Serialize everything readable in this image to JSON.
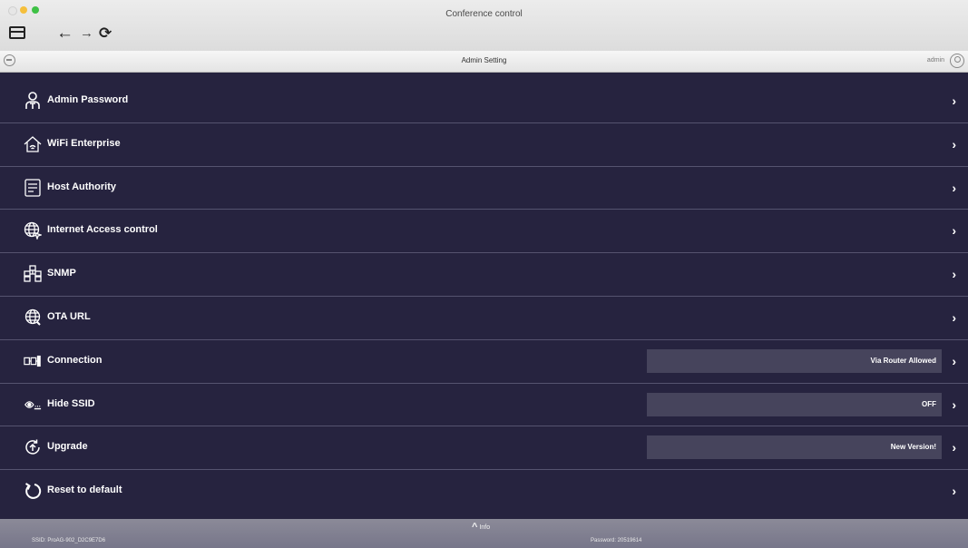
{
  "window": {
    "title": "Conference control"
  },
  "toolbar": {
    "back_label": "←",
    "forward_label": "→",
    "reload_label": "⟳"
  },
  "nav": {
    "title": "Admin Setting",
    "user": "admin"
  },
  "settings": {
    "items": [
      {
        "label": "Admin Password",
        "icon": "admin-user-icon"
      },
      {
        "label": "WiFi Enterprise",
        "icon": "house-wifi-icon"
      },
      {
        "label": "Host Authority",
        "icon": "document-list-icon"
      },
      {
        "label": "Internet Access control",
        "icon": "globe-cursor-icon"
      },
      {
        "label": "SNMP",
        "icon": "network-nodes-icon"
      },
      {
        "label": "OTA URL",
        "icon": "globe-icon"
      },
      {
        "label": "Connection",
        "icon": "connection-icon",
        "value": "Via Router Allowed"
      },
      {
        "label": "Hide SSID",
        "icon": "hide-ssid-icon",
        "value": "OFF"
      },
      {
        "label": "Upgrade",
        "icon": "upgrade-icon",
        "value": "New Version!"
      },
      {
        "label": "Reset to default",
        "icon": "reset-icon"
      }
    ],
    "chevron": "›"
  },
  "footer": {
    "info_label": "Info",
    "ssid": "SSID: ProAG-902_D2C9E7D6",
    "password": "Password: 20519614"
  },
  "colors": {
    "background": "#26233f",
    "row_divider": "#55536f",
    "value_box": "#46445c",
    "footer": "#817f90"
  }
}
